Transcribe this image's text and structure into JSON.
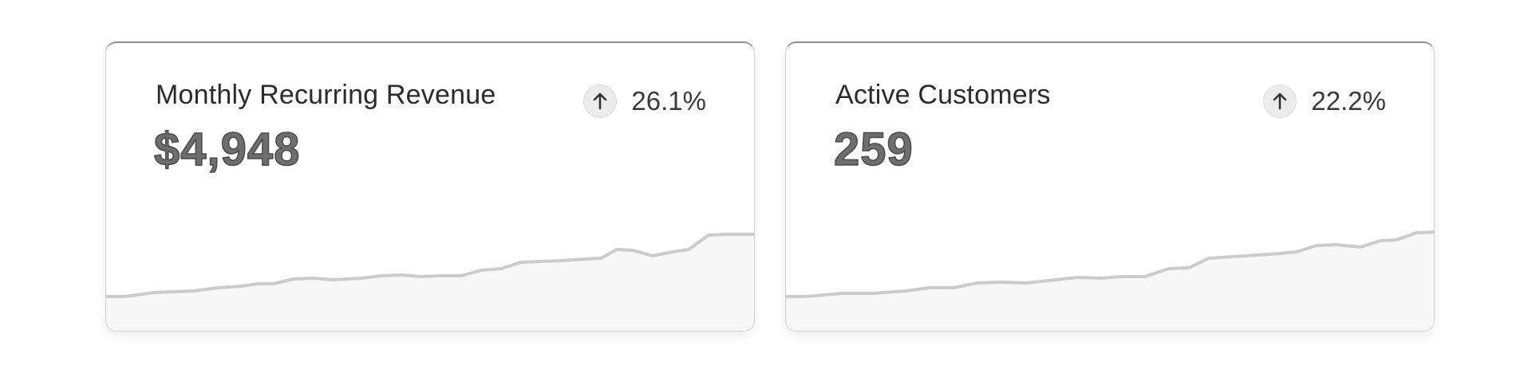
{
  "cards": [
    {
      "title": "Monthly Recurring Revenue",
      "value": "$4,948",
      "delta": "26.1%",
      "trend_icon": "arrow-up-icon"
    },
    {
      "title": "Active Customers",
      "value": "259",
      "delta": "22.2%",
      "trend_icon": "arrow-up-icon"
    }
  ],
  "colors": {
    "line": "#cbcbcb",
    "fill": "#f7f7f7",
    "icon_bg": "#ececec"
  }
}
